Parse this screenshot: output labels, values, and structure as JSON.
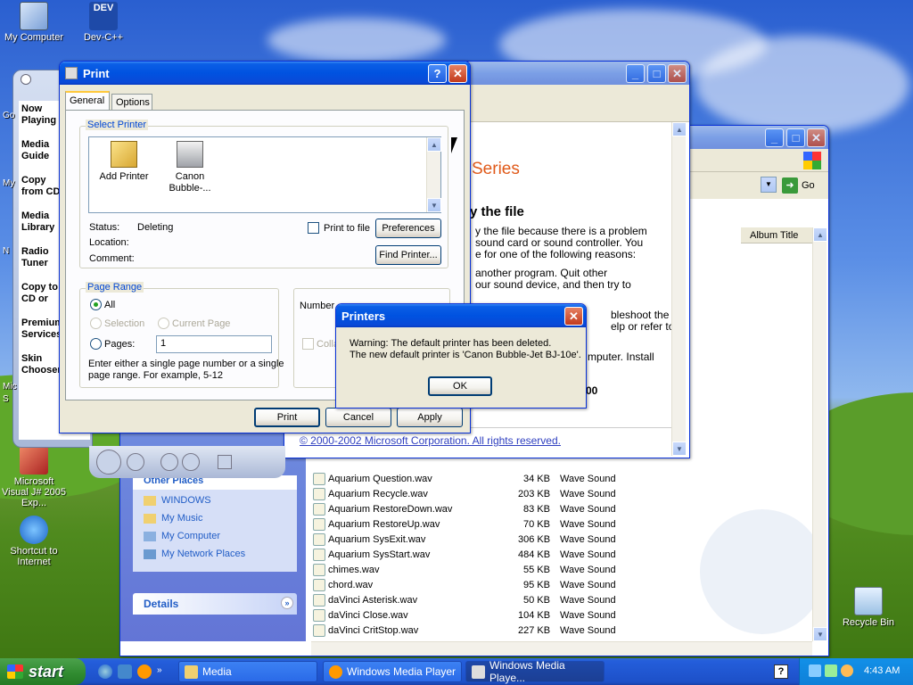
{
  "desktop": {
    "icons": [
      "My Computer",
      "Dev-C++",
      "Microsoft Visual J# 2005 Exp...",
      "Shortcut to Internet",
      "Recycle Bin"
    ],
    "dev_badge": "DEV"
  },
  "wmp": {
    "nav": [
      "Now Playing",
      "Media Guide",
      "Copy from CD",
      "Media Library",
      "Radio Tuner",
      "Copy to CD or Device",
      "Premium Services",
      "Skin Chooser"
    ],
    "side_labels": [
      "Go",
      "My",
      "N",
      "Mic",
      "S"
    ]
  },
  "help": {
    "heading": "Series",
    "subheading": "y the file",
    "para1": [
      "y the file because there is a problem",
      "sound card or sound controller. You",
      "e for one of the following reasons:"
    ],
    "para2": [
      "another program. Quit other",
      "our sound device, and then try to"
    ],
    "para3": [
      "bleshoot the",
      "elp or refer to"
    ],
    "para4": "mputer. Install",
    "num": "00",
    "copyright": "© 2000-2002 Microsoft Corporation. All rights reserved."
  },
  "explorer": {
    "go_label": "Go",
    "album_header": "Album Title",
    "other_places_title": "Other Places",
    "other_places": [
      "WINDOWS",
      "My Music",
      "My Computer",
      "My Network Places"
    ],
    "details_title": "Details",
    "files": [
      {
        "name": "Aquarium Question.wav",
        "size": "34 KB",
        "type": "Wave Sound"
      },
      {
        "name": "Aquarium Recycle.wav",
        "size": "203 KB",
        "type": "Wave Sound"
      },
      {
        "name": "Aquarium RestoreDown.wav",
        "size": "83 KB",
        "type": "Wave Sound"
      },
      {
        "name": "Aquarium RestoreUp.wav",
        "size": "70 KB",
        "type": "Wave Sound"
      },
      {
        "name": "Aquarium SysExit.wav",
        "size": "306 KB",
        "type": "Wave Sound"
      },
      {
        "name": "Aquarium SysStart.wav",
        "size": "484 KB",
        "type": "Wave Sound"
      },
      {
        "name": "chimes.wav",
        "size": "55 KB",
        "type": "Wave Sound"
      },
      {
        "name": "chord.wav",
        "size": "95 KB",
        "type": "Wave Sound"
      },
      {
        "name": "daVinci Asterisk.wav",
        "size": "50 KB",
        "type": "Wave Sound"
      },
      {
        "name": "daVinci Close.wav",
        "size": "104 KB",
        "type": "Wave Sound"
      },
      {
        "name": "daVinci CritStop.wav",
        "size": "227 KB",
        "type": "Wave Sound"
      }
    ]
  },
  "print": {
    "title": "Print",
    "tabs": [
      "General",
      "Options"
    ],
    "select_printer_legend": "Select Printer",
    "printers": [
      "Add Printer",
      "Canon Bubble-..."
    ],
    "status_label": "Status:",
    "status_value": "Deleting",
    "location_label": "Location:",
    "comment_label": "Comment:",
    "print_to_file": "Print to file",
    "preferences": "Preferences",
    "find_printer": "Find Printer...",
    "page_range_legend": "Page Range",
    "all": "All",
    "selection": "Selection",
    "current_page": "Current Page",
    "pages": "Pages:",
    "pages_value": "1",
    "hint": [
      "Enter either a single page number or a single",
      "page range.  For example, 5-12"
    ],
    "number_label": "Number",
    "collate": "Colla",
    "print_btn": "Print",
    "cancel_btn": "Cancel",
    "apply_btn": "Apply"
  },
  "printers_dialog": {
    "title": "Printers",
    "line1": "Warning: The default printer has been deleted.",
    "line2": "The new default printer is 'Canon Bubble-Jet BJ-10e'.",
    "ok": "OK"
  },
  "taskbar": {
    "start": "start",
    "tasks": [
      "Media",
      "Windows Media Player",
      "Windows Media Playe..."
    ],
    "help": "?",
    "clock": "4:43 AM"
  }
}
